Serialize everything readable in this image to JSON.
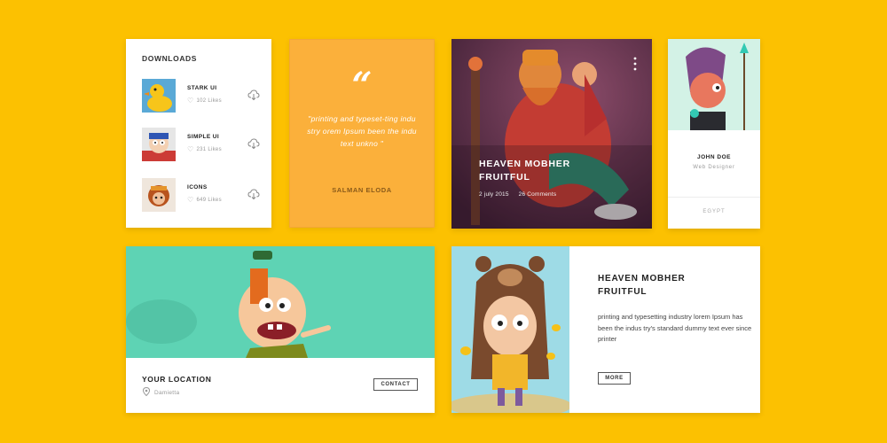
{
  "downloads": {
    "title": "DOWNLOADS",
    "items": [
      {
        "name": "STARK UI",
        "likes": "102 Likes"
      },
      {
        "name": "SIMPLE UI",
        "likes": "231 Likes"
      },
      {
        "name": "ICONS",
        "likes": "649 Likes"
      }
    ]
  },
  "quote": {
    "mark": "“",
    "text": "\"printing and typeset-ting indu stry orem Ipsum been the indu text unkno \"",
    "author": "SALMAN ELODA"
  },
  "feature": {
    "title": "HEAVEN MOBHER FRUITFUL",
    "date": "2 july 2015",
    "comments": "26 Comments"
  },
  "profile": {
    "name": "JOHN DOE",
    "role": "Web Designer",
    "location": "EGYPT"
  },
  "location": {
    "title": "YOUR LOCATION",
    "place": "Damietta",
    "button": "CONTACT"
  },
  "article": {
    "title": "HEAVEN MOBHER FRUITFUL",
    "text": "printing and typesetting industry lorem Ipsum has been the indus try's standard dummy text ever since printer",
    "button": "MORE"
  },
  "colors": {
    "background": "#fcc101",
    "quote_card": "#fbb03b",
    "location_image": "#5ed3b4",
    "profile_image": "#d3f2e6"
  }
}
